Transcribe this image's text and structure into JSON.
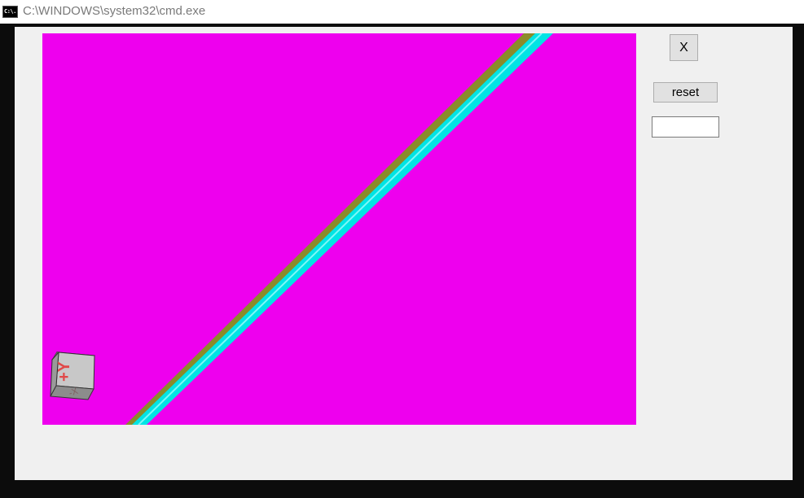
{
  "window": {
    "title": "C:\\WINDOWS\\system32\\cmd.exe",
    "icon_text": "C:\\."
  },
  "controls": {
    "close_label": "X",
    "reset_label": "reset",
    "text_field_value": ""
  },
  "viewport": {
    "background_color": "#ee00ee",
    "rod_color": "#00e4e4",
    "rod_shade_color": "#8b8b2a",
    "orientation_cube": {
      "face_label": "+Y"
    }
  }
}
